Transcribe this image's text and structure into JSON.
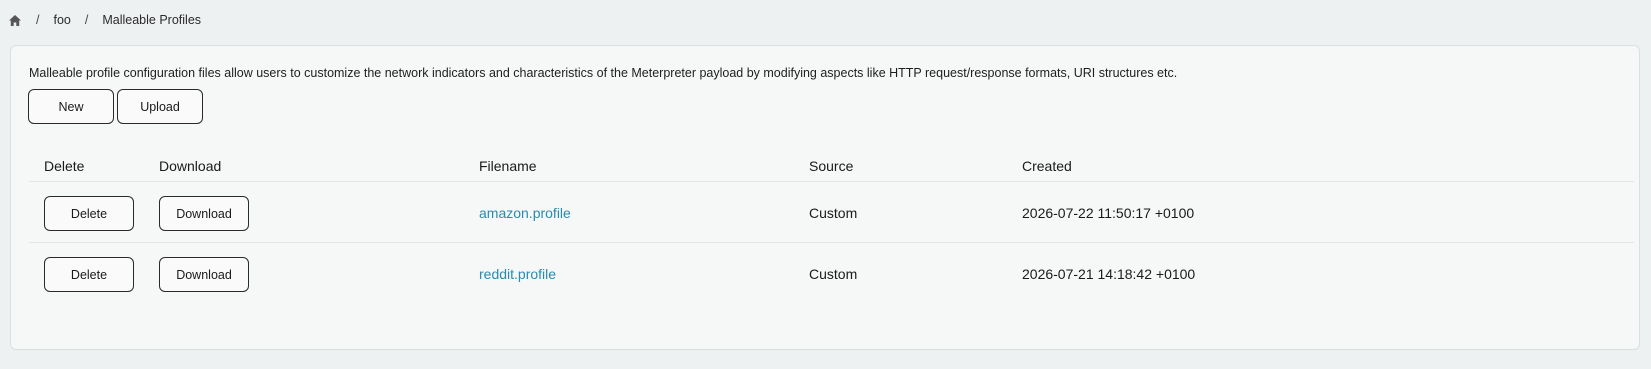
{
  "breadcrumb": {
    "home_icon": "home-icon",
    "separator": "/",
    "items": [
      "foo",
      "Malleable Profiles"
    ]
  },
  "description": "Malleable profile configuration files allow users to customize the network indicators and characteristics of the Meterpreter payload by modifying aspects like HTTP request/response formats, URI structures etc.",
  "toolbar": {
    "new_label": "New",
    "upload_label": "Upload"
  },
  "table": {
    "headers": [
      "Delete",
      "Download",
      "Filename",
      "Source",
      "Created"
    ],
    "rows": [
      {
        "delete_label": "Delete",
        "download_label": "Download",
        "filename": "amazon.profile",
        "source": "Custom",
        "created": "2026-07-22 11:50:17 +0100"
      },
      {
        "delete_label": "Delete",
        "download_label": "Download",
        "filename": "reddit.profile",
        "source": "Custom",
        "created": "2026-07-21 14:18:42 +0100"
      }
    ]
  },
  "colors": {
    "background": "#eef1f2",
    "card": "#f6f7f7",
    "link": "#2b8ab0"
  }
}
